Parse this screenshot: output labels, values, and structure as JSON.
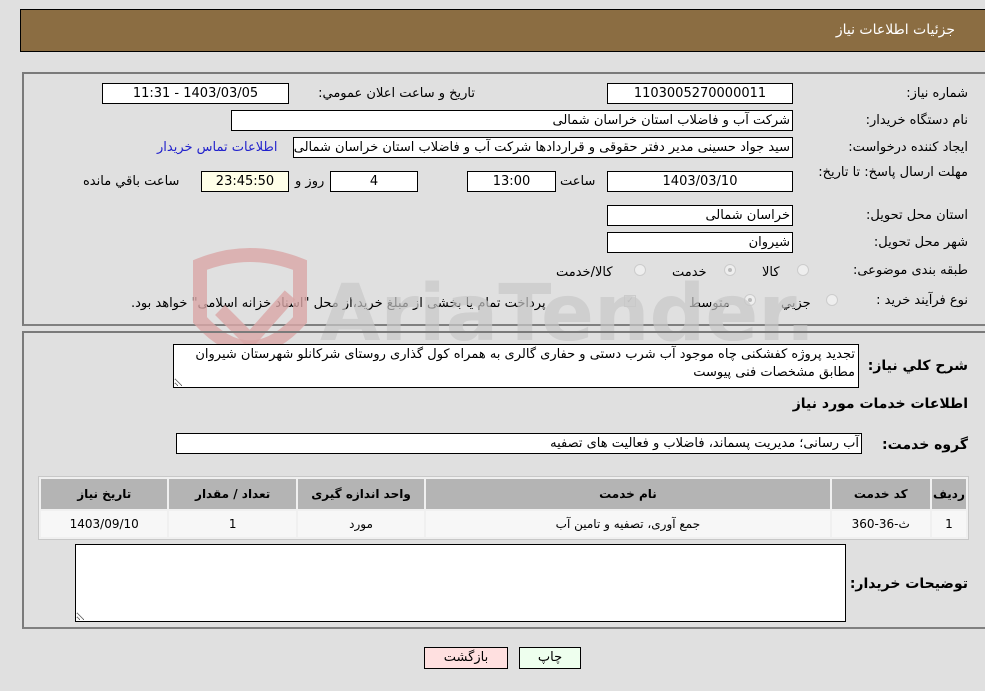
{
  "header": {
    "title": "جزئیات اطلاعات نیاز"
  },
  "form": {
    "need_number": {
      "label": "شماره نیاز:",
      "value": "1103005270000011"
    },
    "announce_datetime": {
      "label": "تاریخ و ساعت اعلان عمومي:",
      "value": "1403/03/05 - 11:31"
    },
    "buyer_org": {
      "label": "نام دستگاه خريدار:",
      "value": "شرکت آب و فاضلاب استان خراسان شمالی"
    },
    "requester": {
      "label": "ایجاد کننده درخواست:",
      "value": "سید جواد حسینی مدیر دفتر حقوقی و قراردادها  شرکت آب و فاضلاب استان خراسان شمالی"
    },
    "contact_link": "اطلاعات تماس خریدار",
    "deadline": {
      "label": "مهلت ارسال پاسخ: تا تاریخ:",
      "date": "1403/03/10",
      "time_label": "ساعت",
      "time": "13:00",
      "days": "4",
      "days_label": "روز و",
      "remaining": "23:45:50",
      "remaining_label": "ساعت باقي مانده"
    },
    "province": {
      "label": "استان محل تحویل:",
      "value": "خراسان شمالی"
    },
    "city": {
      "label": "شهر محل تحویل:",
      "value": "شیروان"
    },
    "category": {
      "label": "طبقه بندی موضوعی:",
      "options": [
        "کالا",
        "خدمت",
        "کالا/خدمت"
      ],
      "selected": "خدمت"
    },
    "purchase_type": {
      "label": "نوع فرآیند خرید :",
      "options": [
        "جزيي",
        "متوسط"
      ],
      "selected": "متوسط",
      "treasury_note": "پرداخت تمام یا بخشی از مبلغ خرید،از محل \"اسناد خزانه اسلامی\" خواهد بود.",
      "treasury_checked": true
    }
  },
  "description": {
    "label": "شرح کلي نياز:",
    "value": "تجدید پروژه کفشکنی چاه موجود آب شرب دستی و حفاری گالری به همراه کول گذاری روستای شرکانلو شهرستان شیروان مطابق مشخصات فنی پیوست"
  },
  "services_section": {
    "title": "اطلاعات خدمات مورد نياز",
    "group_label": "گروه خدمت:",
    "group_value": "آب رسانی؛ مدیریت پسماند، فاضلاب و فعالیت های تصفیه"
  },
  "table": {
    "columns": [
      "رديف",
      "کد خدمت",
      "نام خدمت",
      "واحد اندازه گيری",
      "تعداد / مقدار",
      "تاريخ نياز"
    ],
    "rows": [
      [
        "1",
        "ث-36-360",
        "جمع آوری، تصفیه و تامین آب",
        "مورد",
        "1",
        "1403/09/10"
      ]
    ]
  },
  "buyer_notes": {
    "label": "توضیحات خریدار:",
    "value": ""
  },
  "buttons": {
    "print": "چاپ",
    "back": "بازگشت"
  },
  "watermark": {
    "text": "AriaTender.neT"
  },
  "colors": {
    "header": "#8b6d42",
    "back_button": "#ffe0e0",
    "print_button": "#eeffee",
    "link": "#2222cc"
  }
}
